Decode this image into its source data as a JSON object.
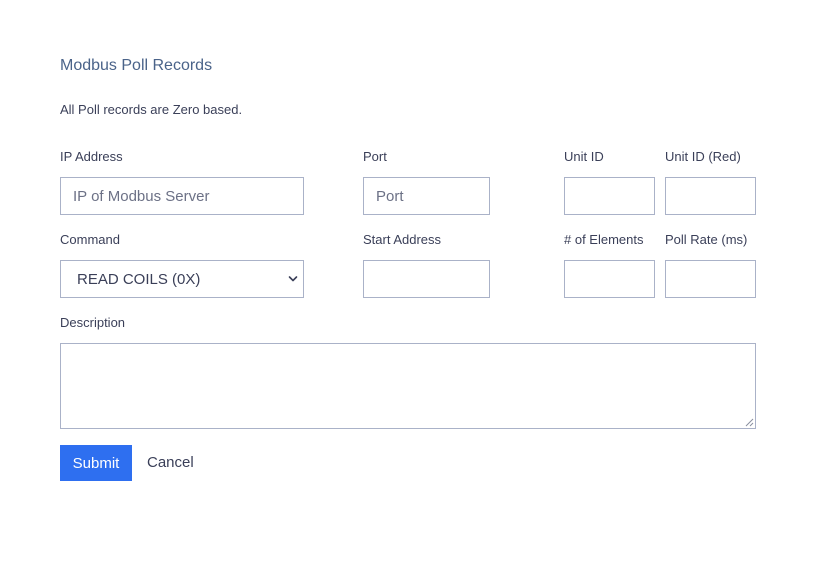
{
  "form": {
    "title": "Modbus Poll Records",
    "note": "All Poll records are Zero based.",
    "ip_address": {
      "label": "IP Address",
      "placeholder": "IP of Modbus Server",
      "value": ""
    },
    "port": {
      "label": "Port",
      "placeholder": "Port",
      "value": ""
    },
    "unit_id": {
      "label": "Unit ID",
      "value": ""
    },
    "unit_id_red": {
      "label": "Unit ID (Red)",
      "value": ""
    },
    "command": {
      "label": "Command",
      "selected": "READ COILS (0X)"
    },
    "start_address": {
      "label": "Start Address",
      "value": ""
    },
    "num_elements": {
      "label": "# of Elements",
      "value": ""
    },
    "poll_rate": {
      "label": "Poll Rate (ms)",
      "value": ""
    },
    "description": {
      "label": "Description",
      "value": ""
    },
    "submit_label": "Submit",
    "cancel_label": "Cancel"
  },
  "icons": {
    "select_chevron": "chevron-down-icon",
    "resize": "resize-handle-icon"
  },
  "colors": {
    "accent": "#2e6ff0",
    "title": "#4a6389",
    "text": "#3a3f58",
    "border": "#aab2c8"
  }
}
